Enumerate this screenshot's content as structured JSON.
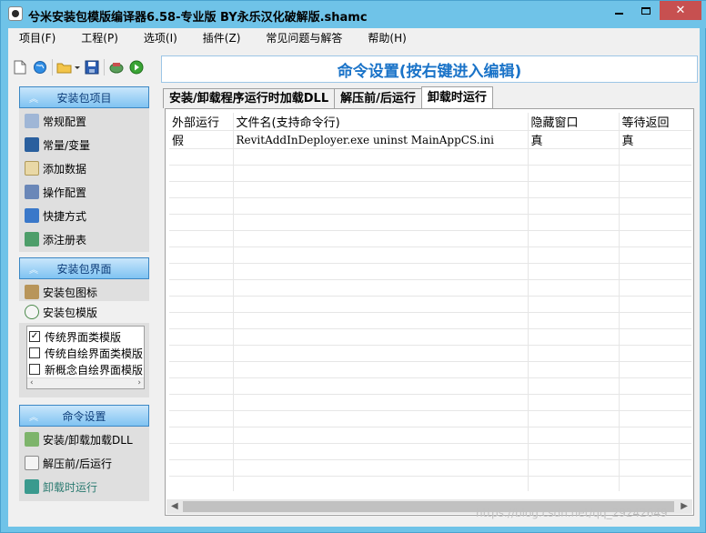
{
  "window": {
    "title": "兮米安装包模版编译器6.58-专业版 BY永乐汉化破解版.shamc"
  },
  "menu": [
    "项目(F)",
    "工程(P)",
    "选项(I)",
    "插件(Z)",
    "常见问题与解答",
    "帮助(H)"
  ],
  "toolbar": {
    "icons": [
      "new-file-icon",
      "open-globe-icon",
      "open-folder-icon",
      "save-icon",
      "build-icon",
      "run-icon"
    ]
  },
  "sidebar": {
    "sections": [
      {
        "title": "安装包项目",
        "items": [
          "常规配置",
          "常量/变量",
          "添加数据",
          "操作配置",
          "快捷方式",
          "添注册表"
        ]
      },
      {
        "title": "安装包界面",
        "items": [
          "安装包图标",
          "安装包模版"
        ],
        "templates": [
          {
            "label": "传统界面类模版",
            "checked": true
          },
          {
            "label": "传统自绘界面类模版",
            "checked": false
          },
          {
            "label": "新概念自绘界面模版",
            "checked": false
          }
        ]
      },
      {
        "title": "命令设置",
        "items": [
          "安装/卸载加载DLL",
          "解压前/后运行",
          "卸载时运行"
        ]
      }
    ]
  },
  "main": {
    "banner": "命令设置(按右键进入编辑)",
    "tabs": [
      "安装/卸载程序运行时加载DLL",
      "解压前/后运行",
      "卸载时运行"
    ],
    "active_tab": 2,
    "table": {
      "columns": [
        "外部运行",
        "文件名(支持命令行)",
        "隐藏窗口",
        "等待返回"
      ],
      "rows": [
        [
          "假",
          "RevitAddInDeployer.exe uninst MainAppCS.ini",
          "真",
          "真"
        ]
      ]
    }
  },
  "watermark": "https://blog.csdn.net/qq_29242649"
}
